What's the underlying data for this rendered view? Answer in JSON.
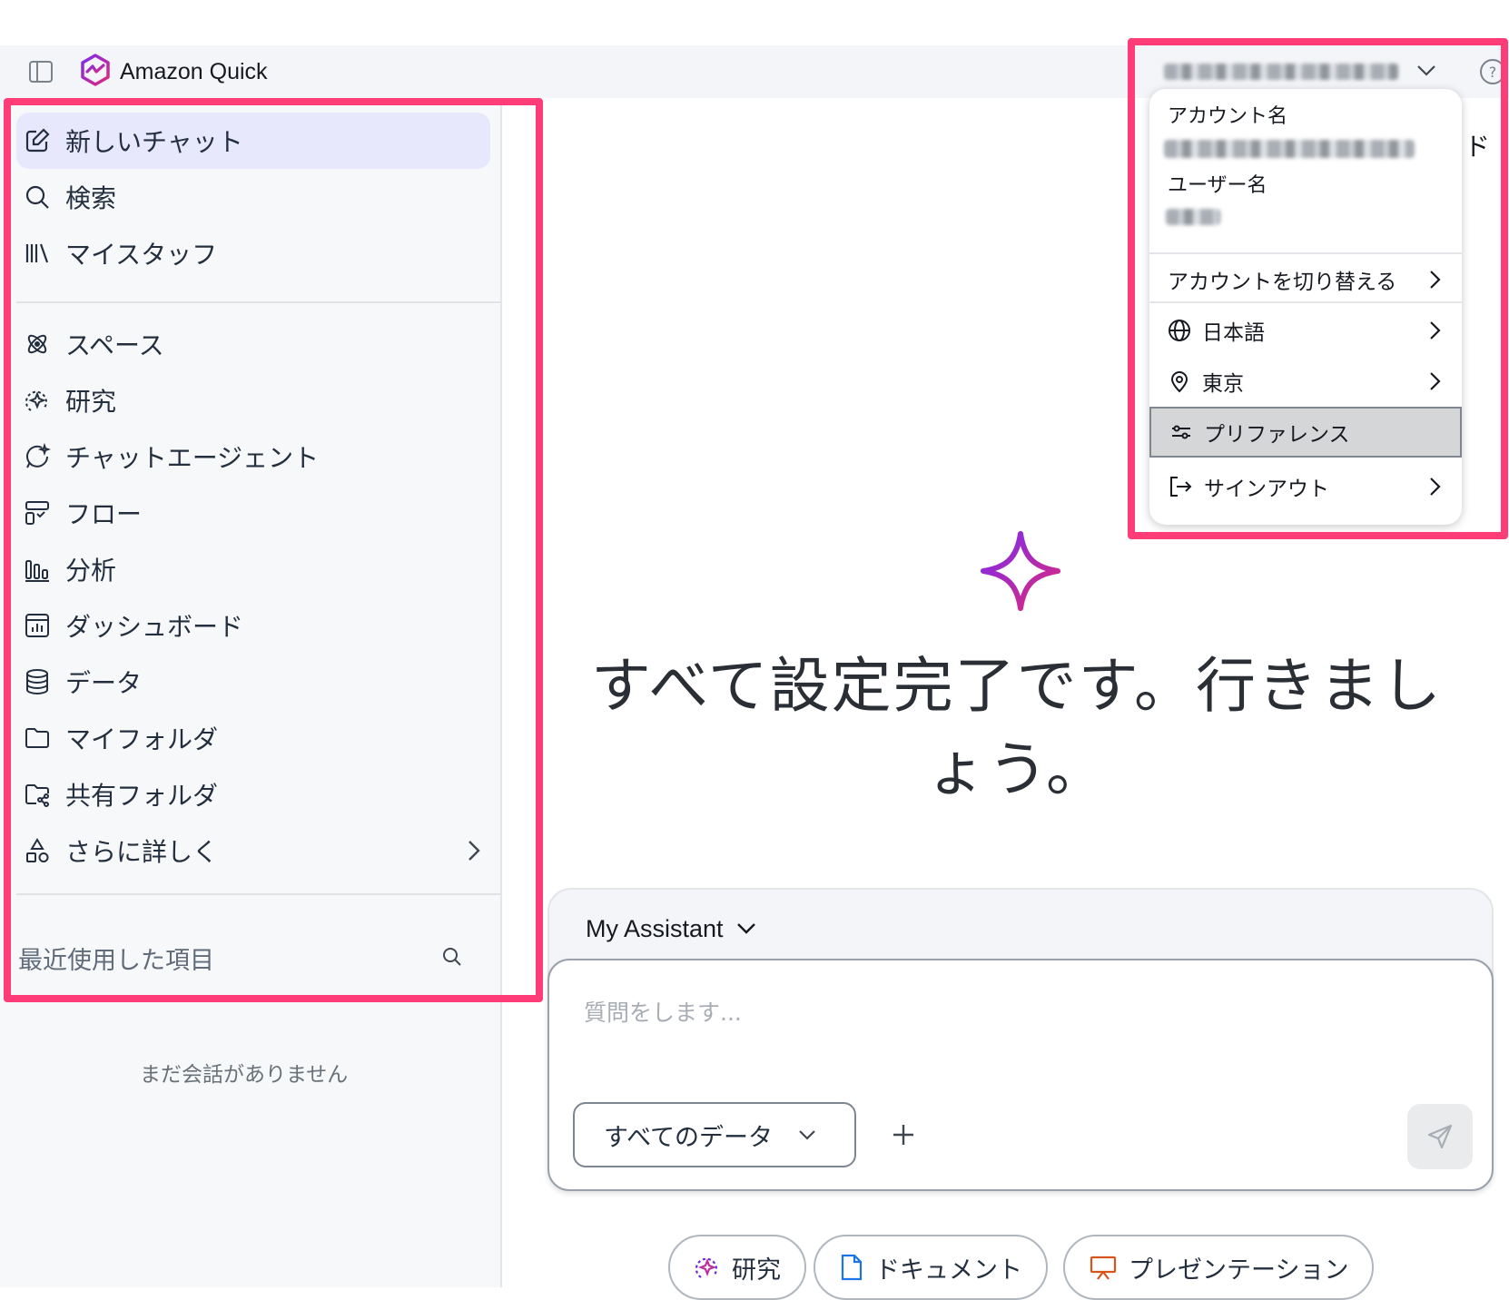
{
  "app": {
    "name": "Amazon Quick"
  },
  "sidebar": {
    "items": [
      {
        "label": "新しいチャット",
        "icon": "edit-icon"
      },
      {
        "label": "検索",
        "icon": "search-icon"
      },
      {
        "label": "マイスタッフ",
        "icon": "library-icon"
      },
      {
        "label": "スペース",
        "icon": "spaces-icon"
      },
      {
        "label": "研究",
        "icon": "research-icon"
      },
      {
        "label": "チャットエージェント",
        "icon": "chat-agent-icon"
      },
      {
        "label": "フロー",
        "icon": "flow-icon"
      },
      {
        "label": "分析",
        "icon": "bar-chart-icon"
      },
      {
        "label": "ダッシュボード",
        "icon": "dashboard-icon"
      },
      {
        "label": "データ",
        "icon": "database-icon"
      },
      {
        "label": "マイフォルダ",
        "icon": "folder-icon"
      },
      {
        "label": "共有フォルダ",
        "icon": "shared-folder-icon"
      },
      {
        "label": "さらに詳しく",
        "icon": "shapes-icon"
      }
    ],
    "recent_label": "最近使用した項目",
    "empty_text": "まだ会話がありません"
  },
  "account_menu": {
    "account_name_label": "アカウント名",
    "user_name_label": "ユーザー名",
    "switch_account": "アカウントを切り替える",
    "language": "日本語",
    "region": "東京",
    "preferences": "プリファレンス",
    "sign_out": "サインアウト"
  },
  "main": {
    "hidden_fragment": "ド",
    "hero_text": "すべて設定完了です。行きましょう。",
    "assistant_label": "My Assistant",
    "input_placeholder": "質問をします...",
    "data_scope": "すべてのデータ",
    "chips": [
      {
        "label": "研究",
        "icon": "research-sparkle-icon"
      },
      {
        "label": "ドキュメント",
        "icon": "document-icon"
      },
      {
        "label": "プレゼンテーション",
        "icon": "presentation-icon"
      }
    ]
  },
  "colors": {
    "highlight": "#fe3c78",
    "active_nav_bg": "#e8e8fd",
    "brand_purple": "#8a2be2",
    "brand_pink": "#e0287a"
  }
}
